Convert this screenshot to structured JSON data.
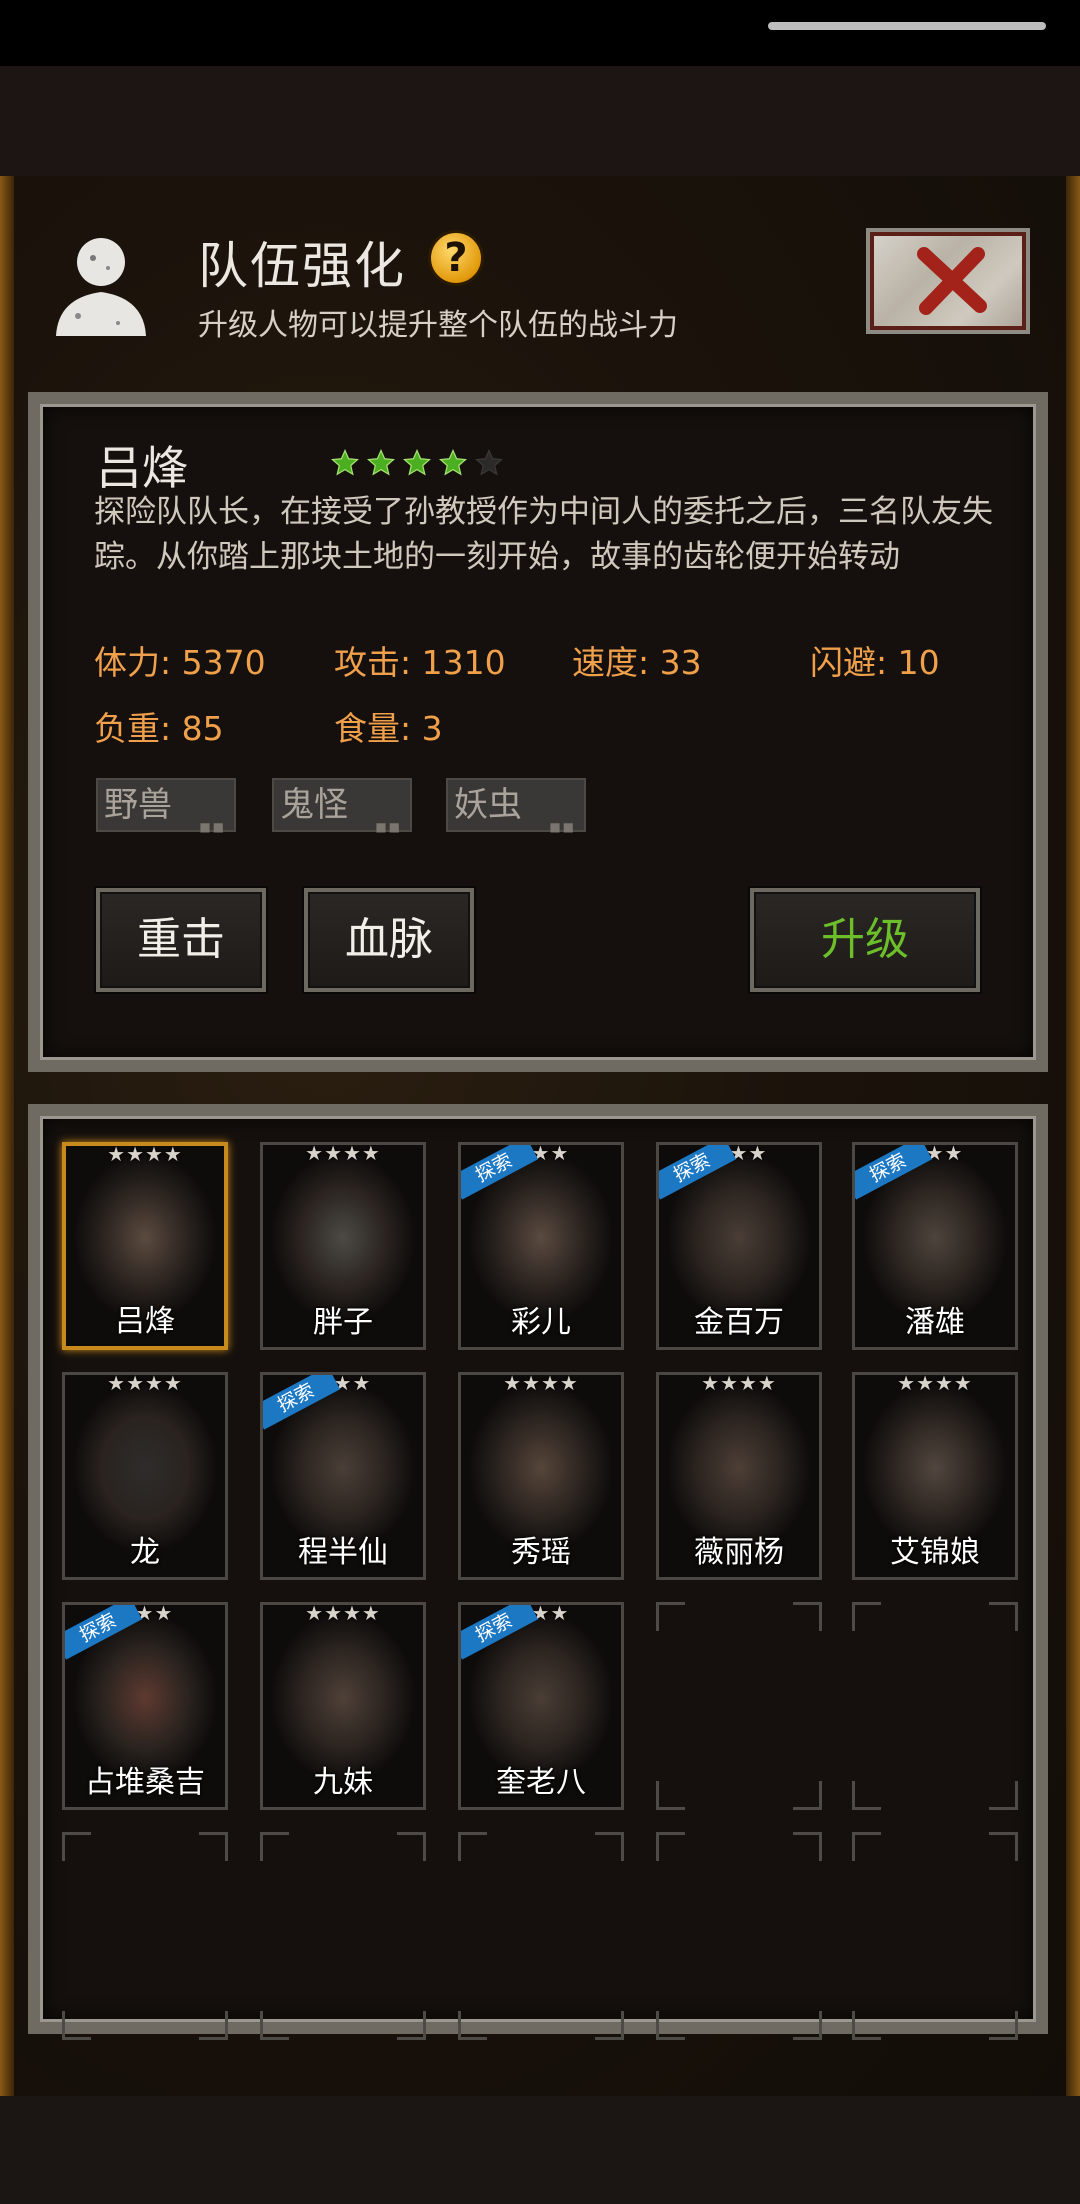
{
  "header": {
    "title": "队伍强化",
    "subtitle": "升级人物可以提升整个队伍的战斗力",
    "help_icon": "?"
  },
  "character": {
    "name": "吕烽",
    "stars_filled": 4,
    "stars_total": 5,
    "description": "探险队队长，在接受了孙教授作为中间人的委托之后，三名队友失踪。从你踏上那块土地的一刻开始，故事的齿轮便开始转动",
    "stats": {
      "hp": "体力: 5370",
      "attack": "攻击: 1310",
      "speed": "速度: 33",
      "dodge": "闪避: 10",
      "load": "负重: 85",
      "food": "食量: 3"
    },
    "tags": [
      "野兽",
      "鬼怪",
      "妖虫"
    ],
    "buttons": {
      "skill1": "重击",
      "skill2": "血脉",
      "upgrade": "升级"
    }
  },
  "roster": {
    "explore_badge": "探索",
    "members": [
      {
        "name": "吕烽",
        "stars": "★★★★",
        "explore": false,
        "selected": true
      },
      {
        "name": "胖子",
        "stars": "★★★★",
        "explore": false,
        "selected": false
      },
      {
        "name": "彩儿",
        "stars": "★★★",
        "explore": true,
        "selected": false
      },
      {
        "name": "金百万",
        "stars": "★★★",
        "explore": true,
        "selected": false
      },
      {
        "name": "潘雄",
        "stars": "★★★",
        "explore": true,
        "selected": false
      },
      {
        "name": "龙",
        "stars": "★★★★",
        "explore": false,
        "selected": false
      },
      {
        "name": "程半仙",
        "stars": "★★★",
        "explore": true,
        "selected": false
      },
      {
        "name": "秀瑶",
        "stars": "★★★★",
        "explore": false,
        "selected": false
      },
      {
        "name": "薇丽杨",
        "stars": "★★★★",
        "explore": false,
        "selected": false
      },
      {
        "name": "艾锦娘",
        "stars": "★★★★",
        "explore": false,
        "selected": false
      },
      {
        "name": "占堆桑吉",
        "stars": "★★★",
        "explore": true,
        "selected": false
      },
      {
        "name": "九妹",
        "stars": "★★★★",
        "explore": false,
        "selected": false
      },
      {
        "name": "奎老八",
        "stars": "★★★",
        "explore": true,
        "selected": false
      }
    ]
  },
  "colors": {
    "stat_orange": "#f0a04a",
    "upgrade_green": "#6cbe2a",
    "star_green": "#4caf22",
    "badge_blue": "#1d78c4",
    "selected_gold": "#c98a1d"
  }
}
